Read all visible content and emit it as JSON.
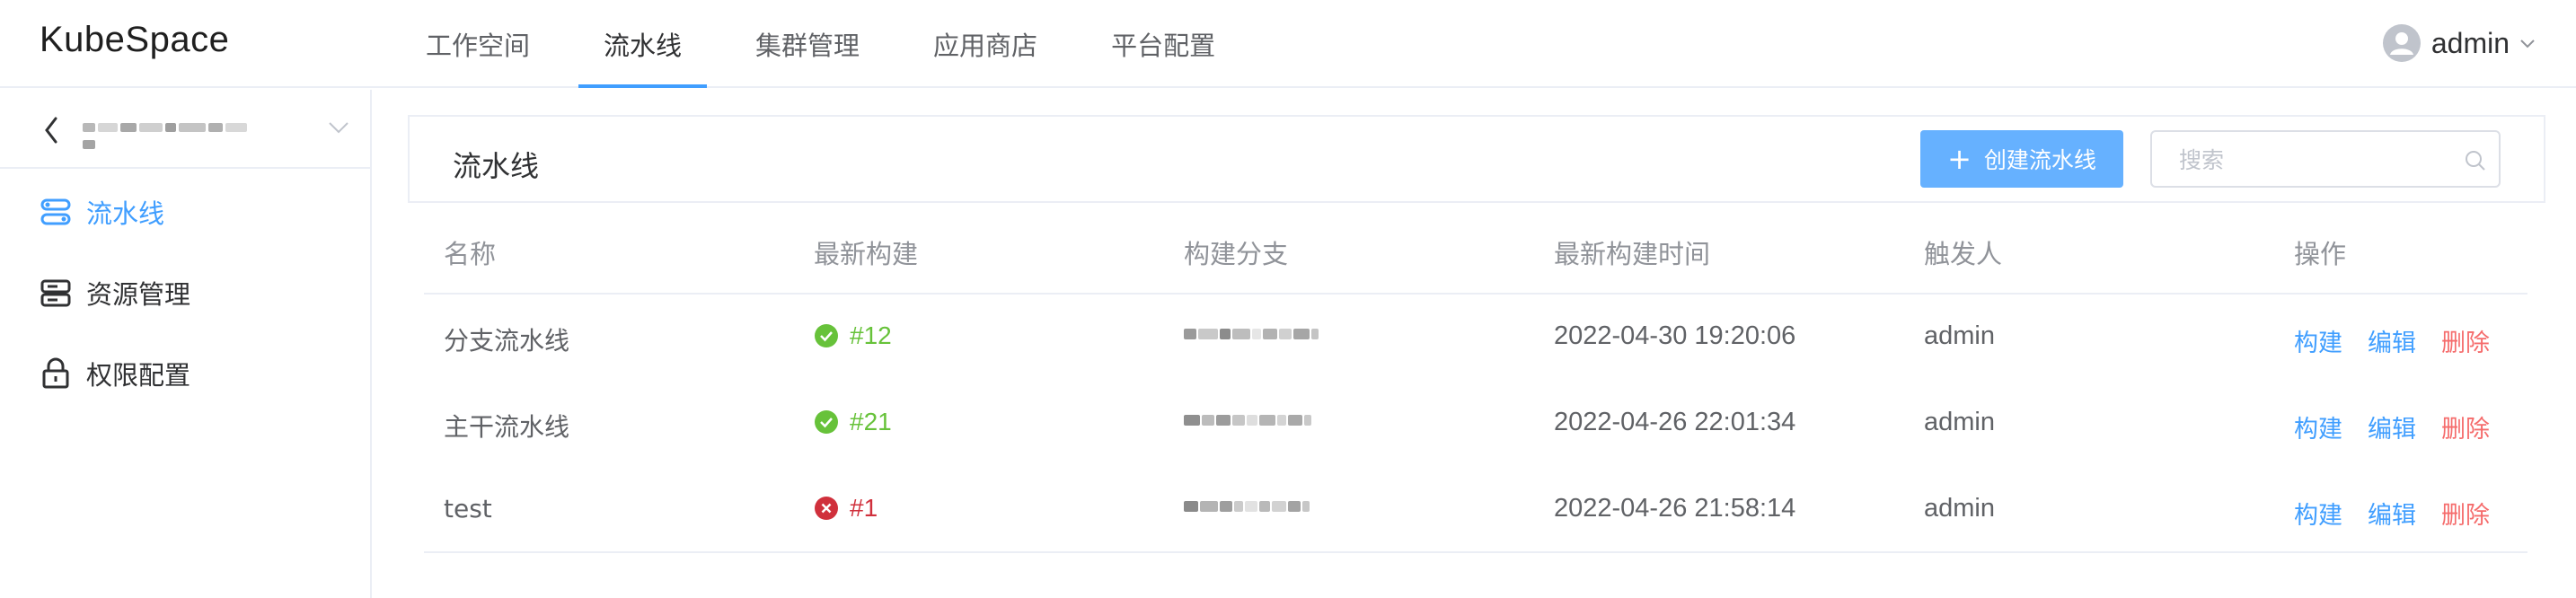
{
  "header": {
    "logo": "KubeSpace",
    "nav": [
      {
        "label": "工作空间"
      },
      {
        "label": "流水线"
      },
      {
        "label": "集群管理"
      },
      {
        "label": "应用商店"
      },
      {
        "label": "平台配置"
      }
    ],
    "active_nav": "流水线",
    "user": "admin"
  },
  "sidebar": {
    "project_icons": [
      "chevron-left-icon",
      "chevron-down-icon"
    ],
    "items": [
      {
        "label": "流水线",
        "icon": "pipeline-icon",
        "active": true
      },
      {
        "label": "资源管理",
        "icon": "server-icon",
        "active": false
      },
      {
        "label": "权限配置",
        "icon": "lock-icon",
        "active": false
      }
    ]
  },
  "main": {
    "title": "流水线",
    "create_button": "创建流水线",
    "search_placeholder": "搜索",
    "table": {
      "columns": [
        "名称",
        "最新构建",
        "构建分支",
        "最新构建时间",
        "触发人",
        "操作"
      ],
      "rows": [
        {
          "name": "分支流水线",
          "build": "#12",
          "status": "success",
          "time": "2022-04-30 19:20:06",
          "trigger": "admin"
        },
        {
          "name": "主干流水线",
          "build": "#21",
          "status": "success",
          "time": "2022-04-26 22:01:34",
          "trigger": "admin"
        },
        {
          "name": "test",
          "build": "#1",
          "status": "failed",
          "time": "2022-04-26 21:58:14",
          "trigger": "admin"
        }
      ],
      "actions": {
        "build": "构建",
        "edit": "编辑",
        "delete": "删除"
      }
    }
  },
  "colors": {
    "accent": "#409eff",
    "success": "#67c23a",
    "failed": "#d0303c",
    "danger": "#f56c6c"
  }
}
